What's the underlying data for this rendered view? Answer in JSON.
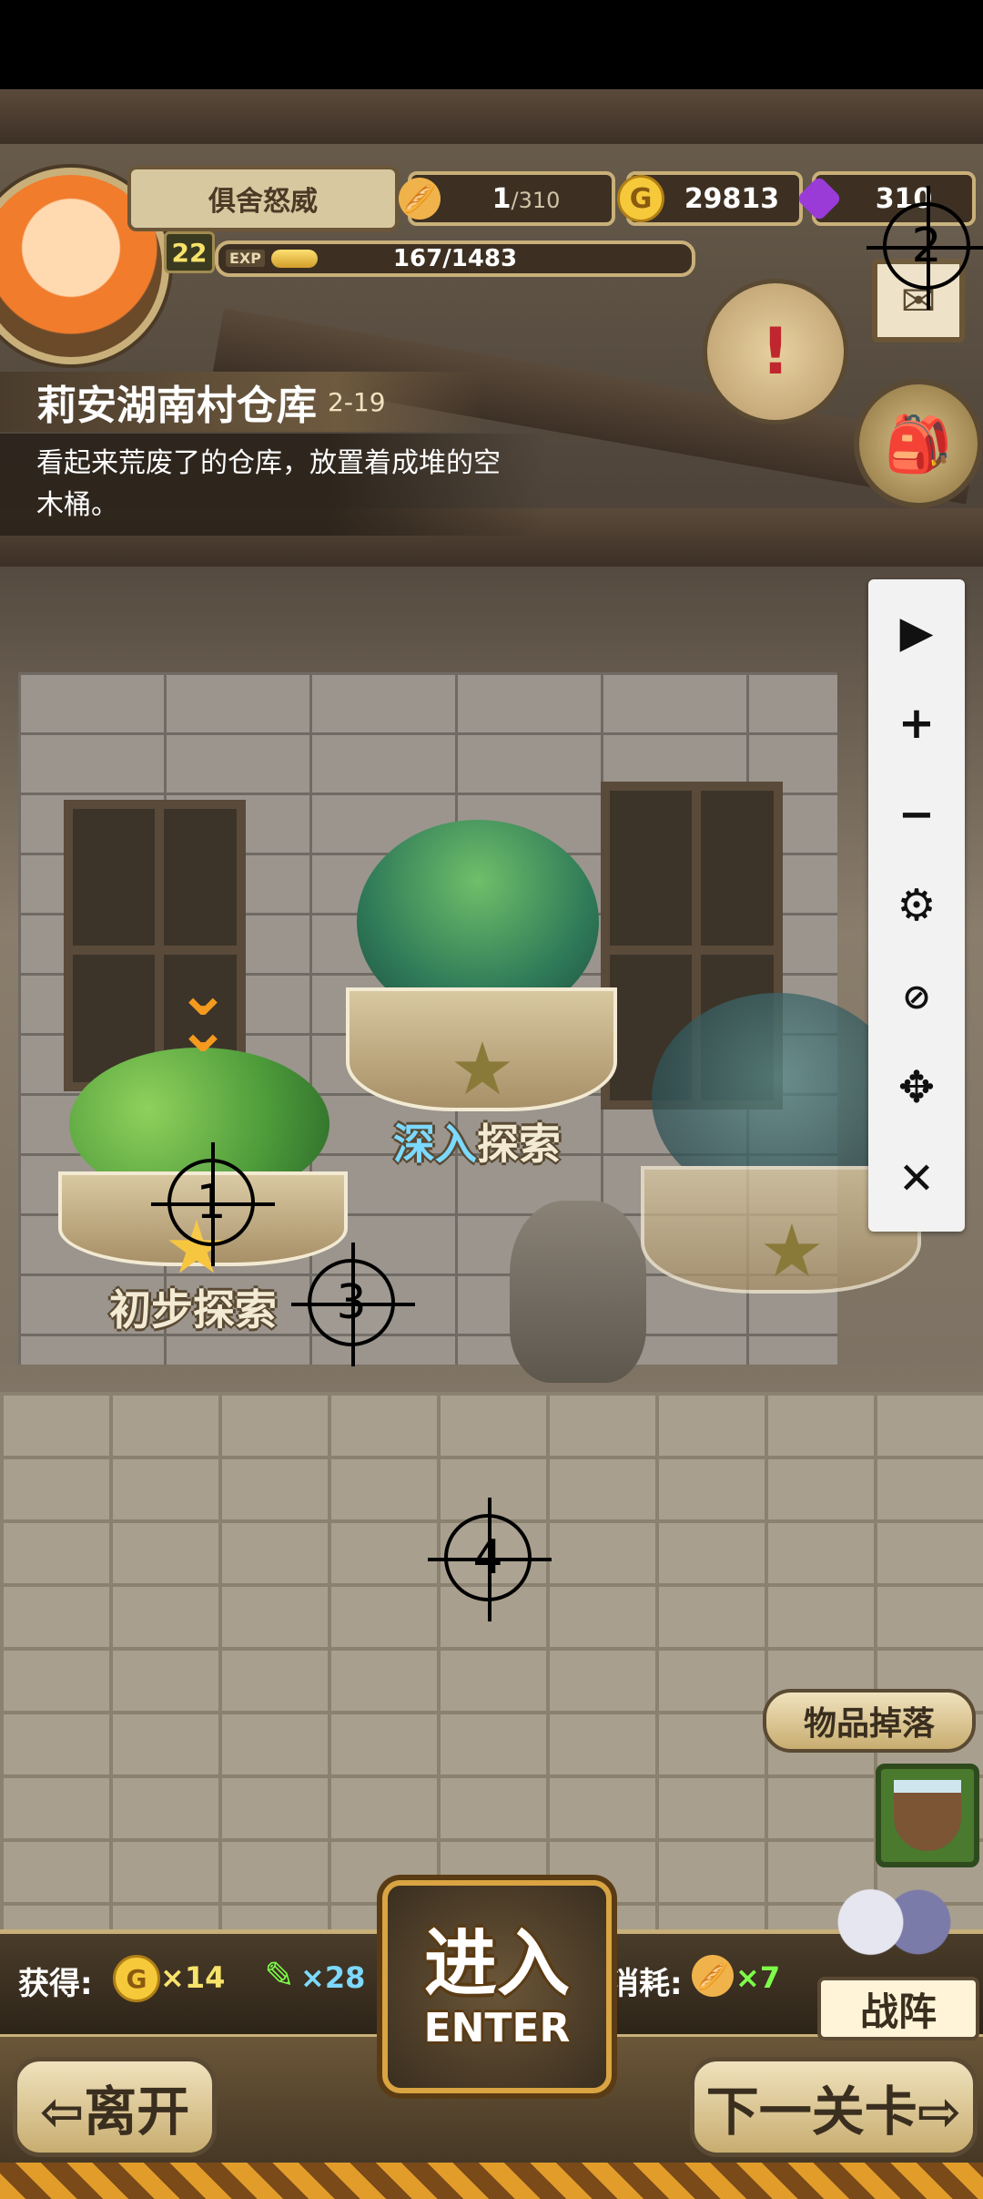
{
  "player": {
    "name": "俱舍怒威",
    "level": "22",
    "exp_label": "EXP",
    "exp_text": "167/1483",
    "exp_progress": 0.113
  },
  "resources": {
    "bread_current": "1",
    "bread_max": "/310",
    "gold": "29813",
    "gold_icon": "G",
    "gems": "310"
  },
  "location": {
    "title": "莉安湖南村仓库",
    "stage": "2-19",
    "description": "看起来荒废了的仓库，放置着成堆的空木桶。"
  },
  "islands": {
    "first": "初步探索",
    "deep": "深入",
    "deep2": "探索"
  },
  "markers": [
    "1",
    "2",
    "3",
    "4"
  ],
  "drops_button": "物品掉落",
  "rewards": {
    "gain_label": "获得:",
    "gold_amount": "×14",
    "feather_amount": "×28",
    "consume_label": "消耗:",
    "bread_amount": "×7"
  },
  "enter": {
    "cn": "进入",
    "en": "ENTER"
  },
  "formation": "战阵",
  "nav": {
    "leave": "⇦离开",
    "next": "下一关卡⇨"
  },
  "colors": {
    "gold": "#f7e36a",
    "gain_green": "#7dff4a",
    "gain_blue": "#7cd9ff",
    "accent_orange": "#e29c2a"
  }
}
